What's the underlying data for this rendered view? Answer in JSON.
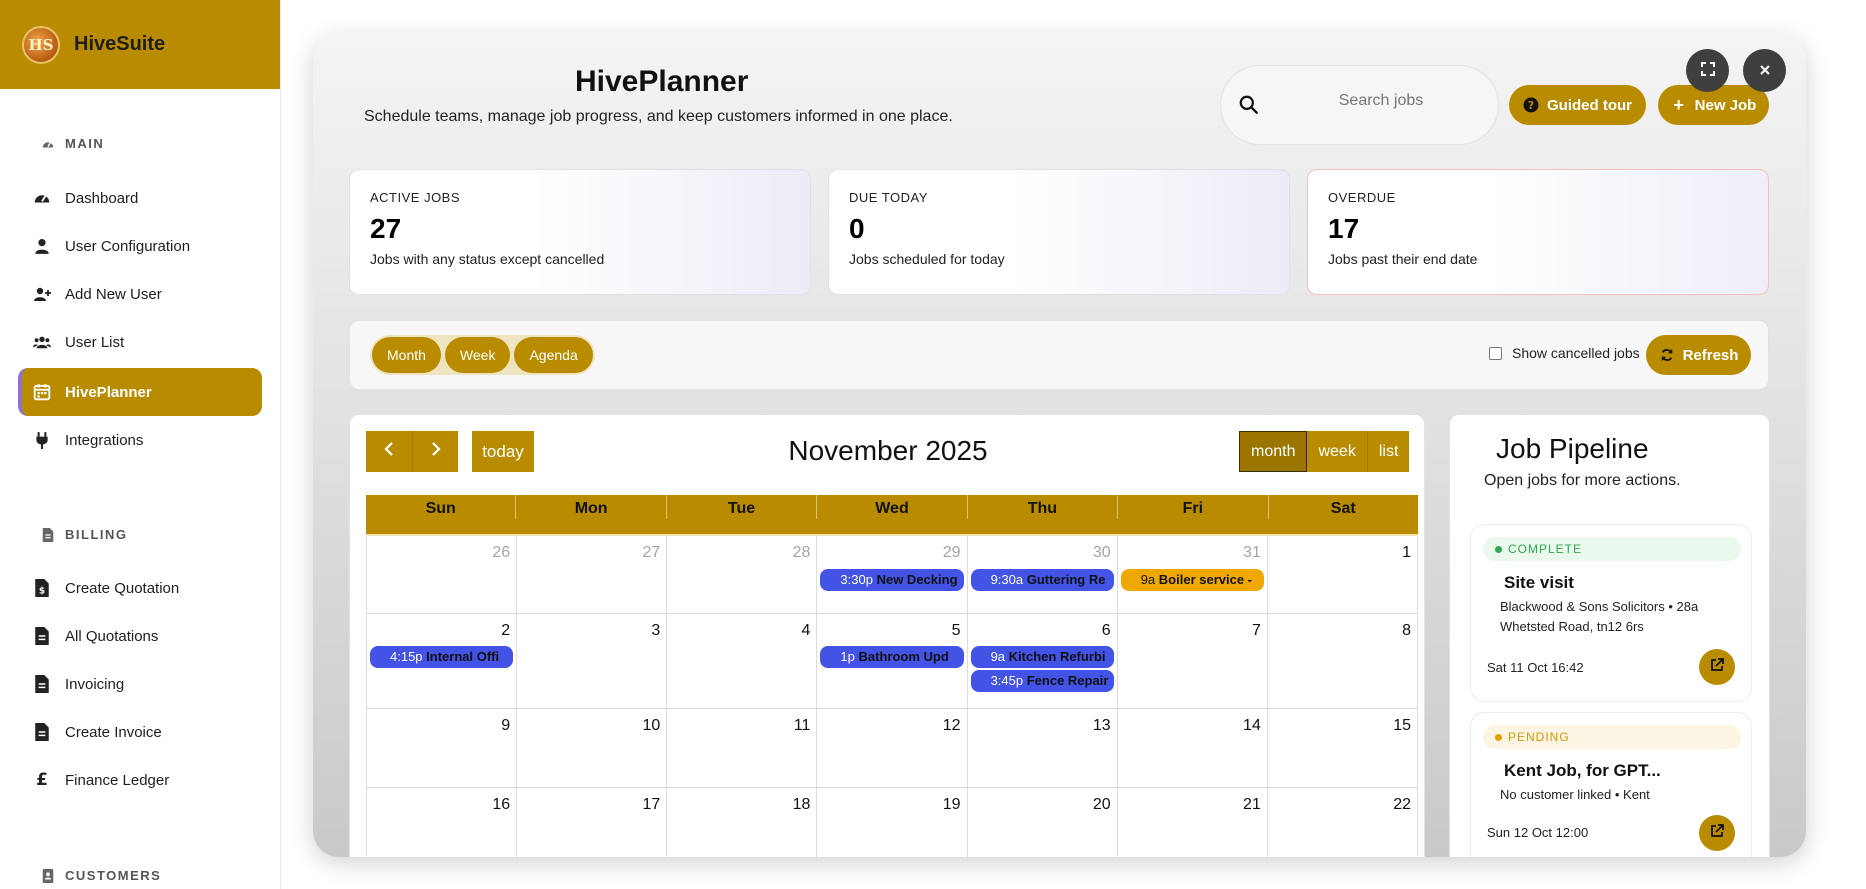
{
  "brand": {
    "name": "HiveSuite",
    "logo_text": "HS"
  },
  "sidebar": {
    "sections": [
      {
        "title": "MAIN",
        "icon": "gauge-icon"
      },
      {
        "title": "BILLING",
        "icon": "file-invoice-icon"
      },
      {
        "title": "CUSTOMERS",
        "icon": "address-book-icon"
      }
    ],
    "main_items": [
      {
        "label": "Dashboard",
        "icon": "gauge-icon"
      },
      {
        "label": "User Configuration",
        "icon": "user-icon"
      },
      {
        "label": "Add New User",
        "icon": "user-plus-icon"
      },
      {
        "label": "User List",
        "icon": "users-icon"
      },
      {
        "label": "HivePlanner",
        "icon": "calendar-icon",
        "active": true
      },
      {
        "label": "Integrations",
        "icon": "plug-icon"
      }
    ],
    "billing_items": [
      {
        "label": "Create Quotation",
        "icon": "file-dollar-icon"
      },
      {
        "label": "All Quotations",
        "icon": "file-lines-icon"
      },
      {
        "label": "Invoicing",
        "icon": "file-lines-icon"
      },
      {
        "label": "Create Invoice",
        "icon": "file-lines-icon"
      },
      {
        "label": "Finance Ledger",
        "icon": "pound-icon"
      }
    ]
  },
  "header": {
    "title": "HivePlanner",
    "subtitle": "Schedule teams, manage job progress, and keep customers informed in one place.",
    "search_placeholder": "Search jobs",
    "guided_tour": "Guided tour",
    "new_job": "New Job"
  },
  "stats": [
    {
      "label": "ACTIVE JOBS",
      "value": "27",
      "desc": "Jobs with any status except cancelled"
    },
    {
      "label": "DUE TODAY",
      "value": "0",
      "desc": "Jobs scheduled for today"
    },
    {
      "label": "OVERDUE",
      "value": "17",
      "desc": "Jobs past their end date"
    }
  ],
  "toolbar": {
    "views": [
      "Month",
      "Week",
      "Agenda"
    ],
    "show_cancelled": "Show cancelled jobs",
    "refresh": "Refresh"
  },
  "calendar": {
    "title": "November 2025",
    "today": "today",
    "views": [
      "month",
      "week",
      "list"
    ],
    "days_of_week": [
      "Sun",
      "Mon",
      "Tue",
      "Wed",
      "Thu",
      "Fri",
      "Sat"
    ],
    "weeks": [
      [
        "26",
        "27",
        "28",
        "29",
        "30",
        "31",
        "1"
      ],
      [
        "2",
        "3",
        "4",
        "5",
        "6",
        "7",
        "8"
      ],
      [
        "9",
        "10",
        "11",
        "12",
        "13",
        "14",
        "15"
      ],
      [
        "16",
        "17",
        "18",
        "19",
        "20",
        "21",
        "22"
      ]
    ],
    "events": [
      {
        "time": "3:30p",
        "title": "New Decking"
      },
      {
        "time": "9:30a",
        "title": "Guttering Re"
      },
      {
        "time": "9a",
        "title": "Boiler service -"
      },
      {
        "time": "4:15p",
        "title": "Internal Offi"
      },
      {
        "time": "1p",
        "title": "Bathroom Upd"
      },
      {
        "time": "9a",
        "title": "Kitchen Refurbi"
      },
      {
        "time": "3:45p",
        "title": "Fence Repair"
      }
    ]
  },
  "pipeline": {
    "title": "Job Pipeline",
    "subtitle": "Open jobs for more actions.",
    "cards": [
      {
        "status": "COMPLETE",
        "title": "Site visit",
        "desc": "Blackwood & Sons Solicitors • 28a Whetsted Road, tn12 6rs",
        "date": "Sat 11 Oct 16:42"
      },
      {
        "status": "PENDING",
        "title": "Kent Job, for GPT...",
        "desc": "No customer linked • Kent",
        "date": "Sun 12 Oct 12:00"
      }
    ]
  },
  "colors": {
    "accent": "#b98c00",
    "event_blue": "#4353e6",
    "event_orange": "#efa800",
    "complete": "#2fa84f",
    "pending": "#e0a100"
  }
}
